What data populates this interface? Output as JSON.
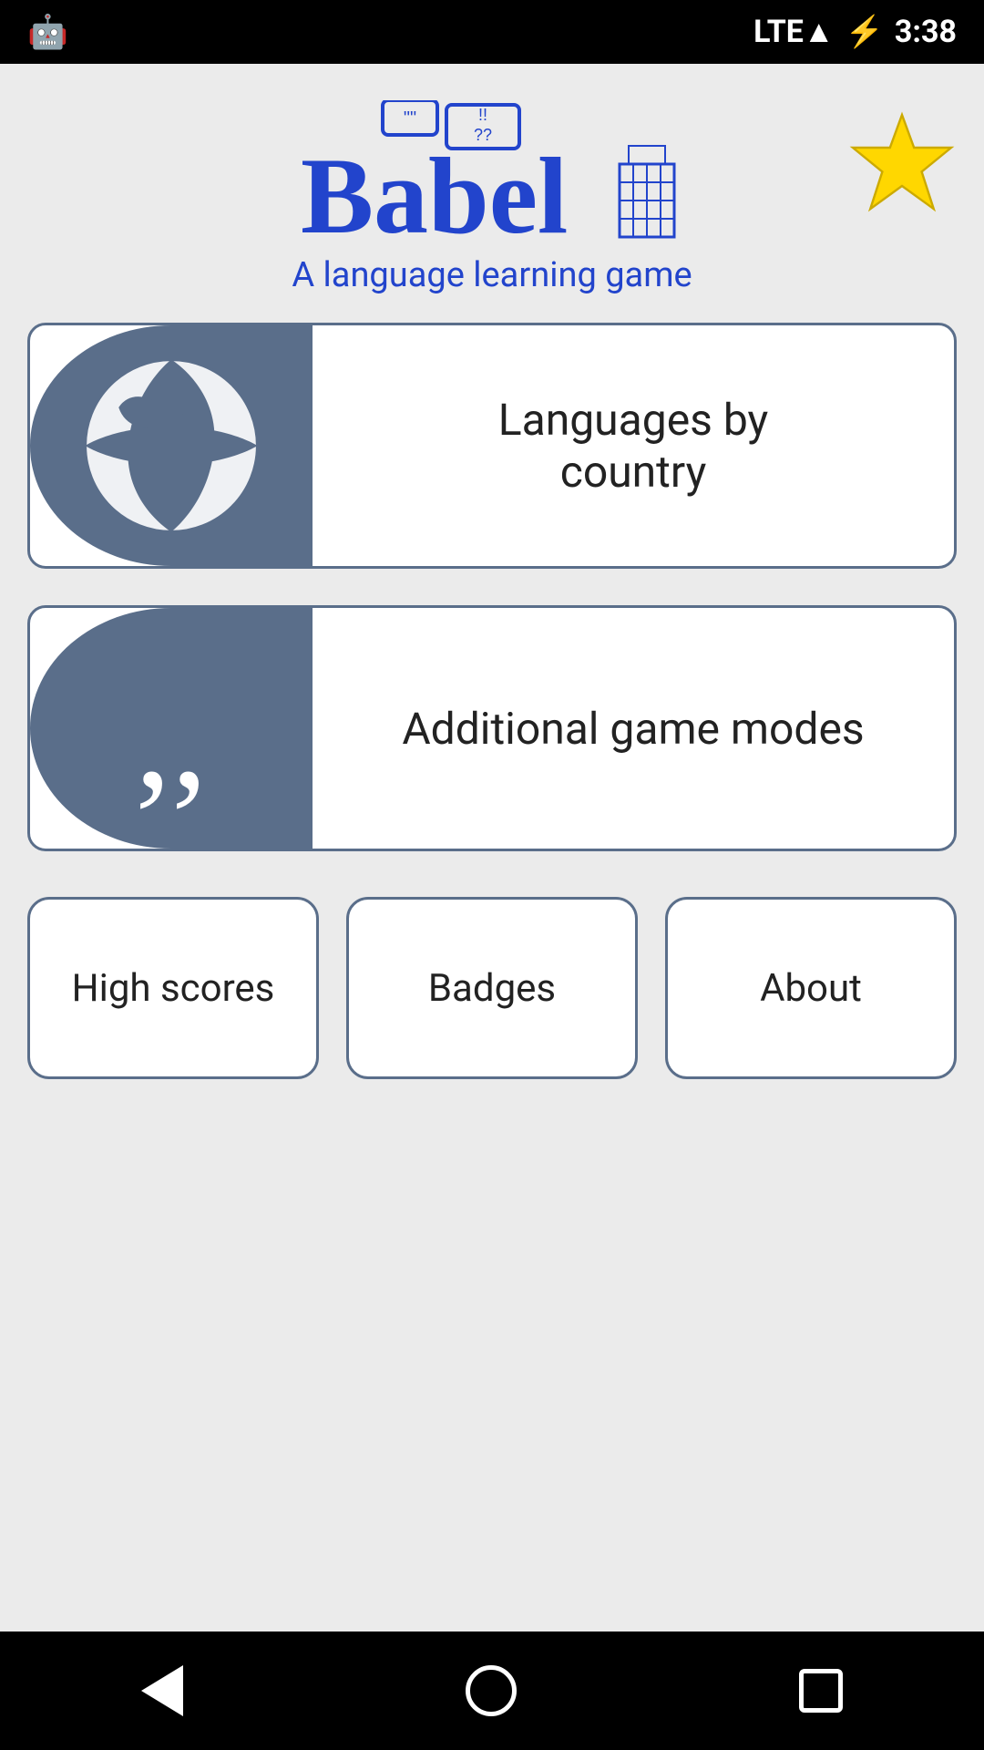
{
  "statusBar": {
    "time": "3:38",
    "networkType": "LTE",
    "batteryIcon": "🔋",
    "androidIcon": "🤖"
  },
  "header": {
    "logoText": "Babel",
    "subtitle": "A language learning game",
    "starIcon": "★"
  },
  "gameButtons": [
    {
      "id": "languages-by-country",
      "label": "Languages by\ncountry",
      "iconType": "globe"
    },
    {
      "id": "additional-game-modes",
      "label": "Additional game modes",
      "iconType": "quotes"
    }
  ],
  "bottomButtons": [
    {
      "id": "high-scores",
      "label": "High scores"
    },
    {
      "id": "badges",
      "label": "Badges"
    },
    {
      "id": "about",
      "label": "About"
    }
  ],
  "navBar": {
    "backLabel": "back",
    "homeLabel": "home",
    "recentLabel": "recent"
  },
  "colors": {
    "slateBlue": "#5a6e8a",
    "logoBlue": "#2244cc",
    "starYellow": "#FFD700",
    "white": "#ffffff",
    "black": "#000000",
    "bgGray": "#ebebeb"
  }
}
